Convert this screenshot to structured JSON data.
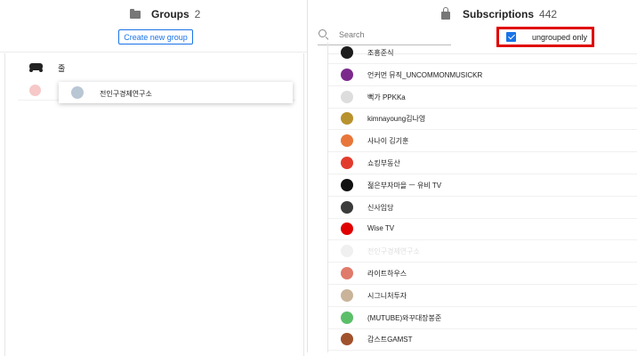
{
  "groups_panel": {
    "title": "Groups",
    "count": "2",
    "create_button": "Create new group",
    "group_name": "줄",
    "dragging_item": "전인구경제연구소"
  },
  "subscriptions_panel": {
    "title": "Subscriptions",
    "count": "442",
    "search_placeholder": "Search",
    "ungrouped_label": "ungrouped only",
    "ungrouped_checked": true,
    "accent_color": "#1a73e8",
    "highlight_color": "#e00000",
    "items": [
      {
        "name": "조흥준식",
        "avatar_color": "#1d1d1d"
      },
      {
        "name": "언커먼 뮤직_UNCOMMONMUSICKR",
        "avatar_color": "#7b2a8c"
      },
      {
        "name": "뻑가 PPKKa",
        "avatar_color": "#dddddd"
      },
      {
        "name": "kimnayoung김나영",
        "avatar_color": "#b8922e"
      },
      {
        "name": "사나이 김기훈",
        "avatar_color": "#e8763a"
      },
      {
        "name": "쇼킹부동산",
        "avatar_color": "#e23b2e"
      },
      {
        "name": "젊은부자마을 ㅡ 유비 TV",
        "avatar_color": "#111111"
      },
      {
        "name": "신사임당",
        "avatar_color": "#3b3b3b"
      },
      {
        "name": "Wise TV",
        "avatar_color": "#e00000"
      },
      {
        "name": "전인구경제연구소",
        "avatar_color": "#f0f0f0",
        "dimmed": true
      },
      {
        "name": "라이트하우스",
        "avatar_color": "#e07a6a"
      },
      {
        "name": "시그니처투자",
        "avatar_color": "#c9b49a"
      },
      {
        "name": "(MUTUBE)와꾸대장봉준",
        "avatar_color": "#5bbf6a"
      },
      {
        "name": "감스트GAMST",
        "avatar_color": "#a0522d"
      }
    ]
  }
}
